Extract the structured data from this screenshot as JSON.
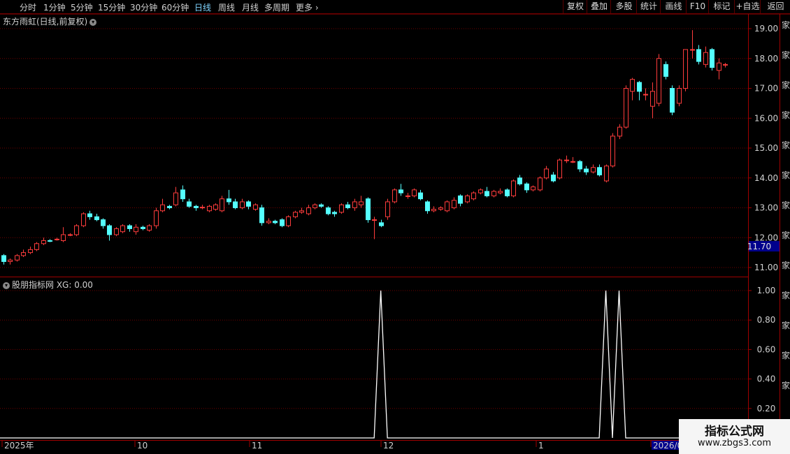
{
  "toolbar": {
    "periods": [
      "分时",
      "1分钟",
      "5分钟",
      "15分钟",
      "30分钟",
      "60分钟",
      "日线",
      "周线",
      "月线",
      "多周期",
      "更多"
    ],
    "active_period": "日线",
    "actions": [
      "复权",
      "叠加",
      "多股",
      "统计",
      "画线",
      "F10",
      "标记",
      "+自选",
      "返回"
    ]
  },
  "main_chart": {
    "title": "东方雨虹(日线,前复权)",
    "price_label": "11.70",
    "colors": {
      "up": "#ff3c3c",
      "down": "#54ffff",
      "grid": "#6e0000",
      "axis": "#a00000",
      "label_bg": "#00008c"
    }
  },
  "indicator": {
    "title": "股朋指标网 XG: 0.00",
    "color": "#ffffff"
  },
  "x_axis": {
    "labels": [
      "2025年",
      "10",
      "11",
      "12",
      "1",
      "2026/0"
    ]
  },
  "side_strip_text": [
    "家",
    "家",
    "家",
    "家",
    "家",
    "家",
    "家",
    "家",
    "家",
    "家",
    "家",
    "家",
    "家"
  ],
  "watermark": {
    "line1": "指标公式网",
    "line2": "www.zbgs3.com"
  },
  "chart_data": [
    {
      "type": "candlestick",
      "title": "东方雨虹(日线,前复权)",
      "y_ticks": [
        "19.00",
        "18.00",
        "17.00",
        "16.00",
        "15.00",
        "14.00",
        "13.00",
        "12.00",
        "11.00"
      ],
      "ylim": [
        10.7,
        19.4
      ],
      "candles": [
        [
          11.4,
          11.2,
          11.45,
          11.1
        ],
        [
          11.2,
          11.25,
          11.3,
          11.1
        ],
        [
          11.25,
          11.4,
          11.45,
          11.2
        ],
        [
          11.4,
          11.5,
          11.6,
          11.35
        ],
        [
          11.5,
          11.6,
          11.7,
          11.45
        ],
        [
          11.6,
          11.8,
          11.85,
          11.55
        ],
        [
          11.8,
          11.9,
          12.0,
          11.75
        ],
        [
          11.9,
          11.88,
          11.95,
          11.85
        ],
        [
          11.95,
          11.95,
          12.0,
          11.9
        ],
        [
          11.9,
          12.1,
          12.35,
          11.85
        ],
        [
          12.1,
          12.1,
          12.15,
          12.05
        ],
        [
          12.1,
          12.4,
          12.45,
          12.05
        ],
        [
          12.4,
          12.8,
          12.85,
          12.35
        ],
        [
          12.8,
          12.7,
          12.9,
          12.6
        ],
        [
          12.7,
          12.6,
          12.8,
          12.55
        ],
        [
          12.6,
          12.4,
          12.65,
          12.3
        ],
        [
          12.4,
          12.1,
          12.45,
          11.9
        ],
        [
          12.1,
          12.3,
          12.35,
          12.05
        ],
        [
          12.2,
          12.4,
          12.45,
          12.15
        ],
        [
          12.4,
          12.3,
          12.45,
          12.2
        ],
        [
          12.2,
          12.35,
          12.45,
          12.1
        ],
        [
          12.35,
          12.3,
          12.4,
          12.25
        ],
        [
          12.25,
          12.4,
          12.45,
          12.2
        ],
        [
          12.4,
          12.9,
          13.0,
          12.3
        ],
        [
          12.9,
          13.1,
          13.3,
          12.85
        ],
        [
          13.05,
          13.0,
          13.1,
          12.95
        ],
        [
          13.1,
          13.5,
          13.7,
          13.05
        ],
        [
          13.6,
          13.3,
          13.75,
          13.2
        ],
        [
          13.2,
          13.05,
          13.3,
          13.0
        ],
        [
          13.05,
          13.0,
          13.1,
          12.9
        ],
        [
          13.0,
          13.02,
          13.1,
          12.95
        ],
        [
          12.9,
          13.05,
          13.1,
          12.85
        ],
        [
          12.95,
          13.1,
          13.15,
          12.9
        ],
        [
          12.9,
          13.3,
          13.4,
          12.85
        ],
        [
          13.3,
          13.2,
          13.6,
          13.1
        ],
        [
          13.2,
          13.0,
          13.3,
          12.95
        ],
        [
          13.0,
          13.2,
          13.3,
          12.95
        ],
        [
          13.2,
          13.05,
          13.25,
          12.95
        ],
        [
          12.95,
          13.1,
          13.15,
          12.9
        ],
        [
          13.0,
          12.5,
          13.1,
          12.4
        ],
        [
          12.5,
          12.55,
          12.65,
          12.45
        ],
        [
          12.55,
          12.5,
          12.6,
          12.45
        ],
        [
          12.6,
          12.4,
          12.65,
          12.35
        ],
        [
          12.4,
          12.7,
          12.75,
          12.35
        ],
        [
          12.7,
          12.85,
          12.9,
          12.65
        ],
        [
          12.85,
          12.9,
          13.0,
          12.8
        ],
        [
          12.8,
          13.0,
          13.1,
          12.75
        ],
        [
          13.0,
          13.1,
          13.15,
          12.95
        ],
        [
          13.1,
          13.05,
          13.15,
          13.0
        ],
        [
          13.0,
          12.8,
          13.05,
          12.75
        ],
        [
          12.85,
          12.8,
          12.9,
          12.7
        ],
        [
          12.85,
          13.1,
          13.15,
          12.8
        ],
        [
          13.1,
          13.0,
          13.2,
          12.95
        ],
        [
          13.0,
          13.2,
          13.3,
          12.9
        ],
        [
          13.1,
          13.2,
          13.4,
          13.0
        ],
        [
          13.3,
          12.6,
          13.35,
          12.5
        ],
        [
          12.6,
          12.6,
          12.7,
          11.95
        ],
        [
          12.5,
          12.4,
          12.6,
          12.35
        ],
        [
          12.7,
          13.2,
          13.3,
          12.6
        ],
        [
          13.2,
          13.6,
          13.65,
          13.15
        ],
        [
          13.6,
          13.5,
          13.8,
          13.4
        ],
        [
          13.4,
          13.4,
          13.5,
          13.3
        ],
        [
          13.4,
          13.6,
          13.65,
          13.35
        ],
        [
          13.5,
          13.3,
          13.6,
          13.25
        ],
        [
          13.2,
          12.9,
          13.25,
          12.8
        ],
        [
          12.9,
          12.95,
          13.05,
          12.85
        ],
        [
          12.95,
          13.0,
          13.05,
          12.9
        ],
        [
          12.9,
          13.2,
          13.25,
          12.85
        ],
        [
          13.0,
          13.25,
          13.35,
          12.95
        ],
        [
          13.4,
          13.15,
          13.45,
          13.05
        ],
        [
          13.2,
          13.4,
          13.45,
          13.15
        ],
        [
          13.3,
          13.5,
          13.55,
          13.25
        ],
        [
          13.5,
          13.6,
          13.65,
          13.45
        ],
        [
          13.55,
          13.4,
          13.7,
          13.35
        ],
        [
          13.4,
          13.55,
          13.6,
          13.35
        ],
        [
          13.5,
          13.55,
          13.65,
          13.45
        ],
        [
          13.6,
          13.4,
          13.65,
          13.35
        ],
        [
          13.4,
          13.9,
          13.95,
          13.35
        ],
        [
          14.0,
          13.8,
          14.1,
          13.75
        ],
        [
          13.8,
          13.6,
          13.85,
          13.5
        ],
        [
          13.6,
          13.7,
          13.75,
          13.55
        ],
        [
          13.6,
          14.0,
          14.05,
          13.55
        ],
        [
          14.0,
          14.3,
          14.4,
          13.95
        ],
        [
          14.1,
          13.9,
          14.2,
          13.85
        ],
        [
          14.0,
          14.6,
          14.65,
          13.95
        ],
        [
          14.6,
          14.6,
          14.75,
          14.5
        ],
        [
          14.55,
          14.55,
          14.7,
          14.5
        ],
        [
          14.55,
          14.3,
          14.6,
          14.2
        ],
        [
          14.3,
          14.2,
          14.4,
          14.1
        ],
        [
          14.2,
          14.35,
          14.45,
          14.15
        ],
        [
          14.35,
          14.1,
          14.45,
          14.05
        ],
        [
          13.9,
          14.4,
          14.45,
          13.85
        ],
        [
          14.4,
          15.4,
          15.5,
          14.35
        ],
        [
          15.4,
          15.7,
          15.8,
          15.3
        ],
        [
          15.7,
          17.0,
          17.1,
          15.65
        ],
        [
          16.9,
          17.3,
          17.35,
          16.6
        ],
        [
          17.2,
          16.9,
          17.25,
          16.6
        ],
        [
          16.8,
          16.8,
          17.0,
          16.6
        ],
        [
          16.4,
          16.9,
          17.2,
          16.0
        ],
        [
          16.5,
          18.0,
          18.15,
          16.4
        ],
        [
          17.8,
          17.4,
          17.9,
          17.3
        ],
        [
          17.0,
          16.2,
          17.1,
          16.1
        ],
        [
          16.5,
          17.0,
          17.1,
          16.4
        ],
        [
          17.0,
          18.3,
          18.3,
          16.9
        ],
        [
          18.3,
          18.3,
          18.95,
          18.0
        ],
        [
          18.3,
          17.9,
          18.45,
          17.8
        ],
        [
          17.8,
          18.2,
          18.4,
          17.7
        ],
        [
          18.3,
          17.7,
          18.35,
          17.6
        ],
        [
          17.6,
          17.85,
          18.0,
          17.3
        ],
        [
          17.8,
          17.8,
          17.85,
          17.7
        ]
      ]
    },
    {
      "type": "line",
      "series": [
        {
          "name": "XG",
          "signal_candle_indices": [
            57,
            91,
            93
          ]
        }
      ],
      "y_ticks": [
        "1.00",
        "0.80",
        "0.60",
        "0.40",
        "0.20"
      ],
      "ylim": [
        0,
        1
      ]
    }
  ]
}
